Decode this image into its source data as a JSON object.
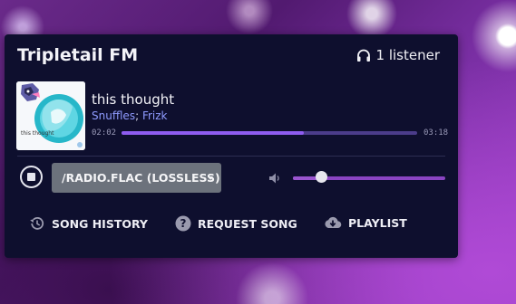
{
  "station": {
    "name": "Tripletail FM",
    "listeners": "1 listener"
  },
  "now_playing": {
    "title": "this thought",
    "artists": [
      "Snuffles",
      "Frizk"
    ],
    "artist_separator": ";",
    "elapsed": "02:02",
    "duration": "03:18",
    "progress_fraction": 0.616,
    "album_art_text": "this thought"
  },
  "controls": {
    "stream_selected": "/RADIO.FLAC (LOSSLESS)",
    "volume_fraction": 0.19
  },
  "actions": {
    "history_label": "SONG HISTORY",
    "request_label": "REQUEST SONG",
    "playlist_label": "PLAYLIST"
  },
  "colors": {
    "card": "#0e0f2e",
    "accent": "#8e5cf0",
    "artist_link": "#8f9bff",
    "select_bg": "#6c727c"
  }
}
